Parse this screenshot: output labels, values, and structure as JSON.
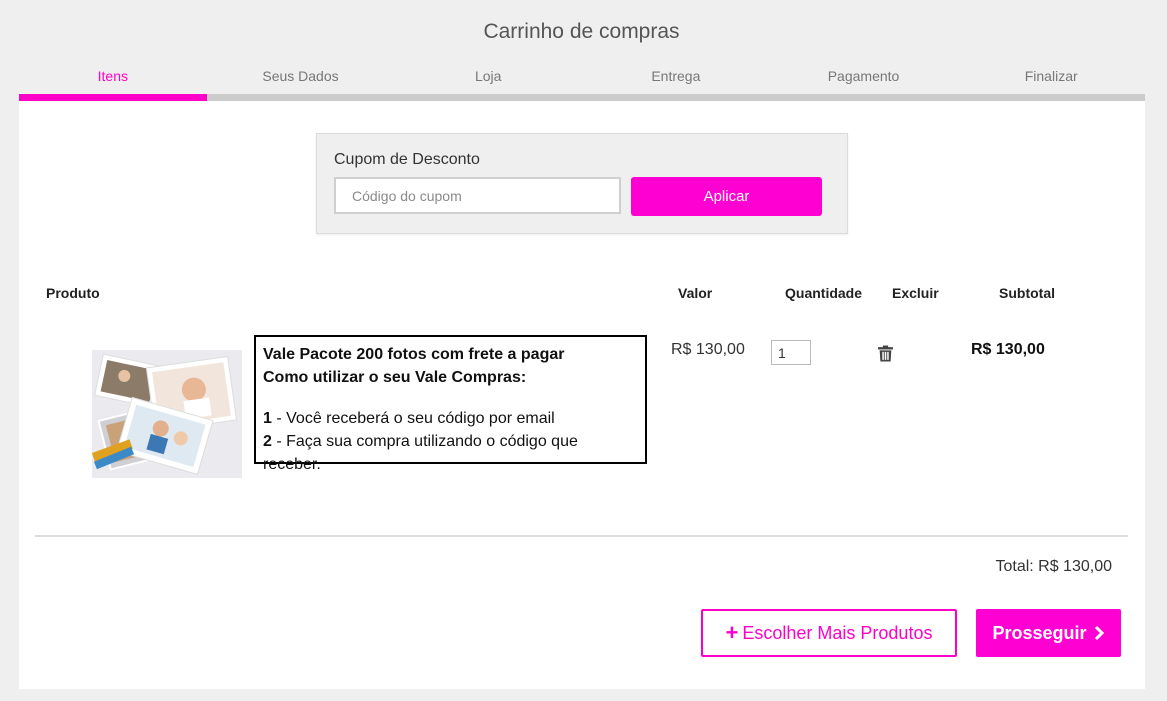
{
  "page": {
    "title": "Carrinho de compras"
  },
  "steps": [
    {
      "label": "Itens",
      "active": true
    },
    {
      "label": "Seus Dados"
    },
    {
      "label": "Loja"
    },
    {
      "label": "Entrega"
    },
    {
      "label": "Pagamento"
    },
    {
      "label": "Finalizar"
    }
  ],
  "progress": {
    "completed_steps": 1,
    "total_steps": 6
  },
  "coupon": {
    "label": "Cupom de Desconto",
    "placeholder": "Código do cupom",
    "value": "",
    "apply_label": "Aplicar"
  },
  "table": {
    "headers": {
      "product": "Produto",
      "value": "Valor",
      "quantity": "Quantidade",
      "delete": "Excluir",
      "subtotal": "Subtotal"
    },
    "item": {
      "title": "Vale Pacote 200 fotos com frete a pagar",
      "subtitle": "Como utilizar o seu Vale Compras:",
      "step1_num": "1",
      "step1_text": " - Você receberá o seu código por email",
      "step2_num": "2",
      "step2_text": " - Faça sua compra utilizando o código que receber.",
      "price": "R$ 130,00",
      "quantity": "1",
      "subtotal": "R$ 130,00"
    }
  },
  "total": "Total: R$ 130,00",
  "actions": {
    "more_icon": "plus-icon",
    "more_label": "Escolher Mais Produtos",
    "proceed_label": "Prosseguir",
    "proceed_icon": "chevron-right-icon"
  },
  "colors": {
    "accent": "#ff00c8",
    "background": "#efefef",
    "track": "#cccccc"
  }
}
